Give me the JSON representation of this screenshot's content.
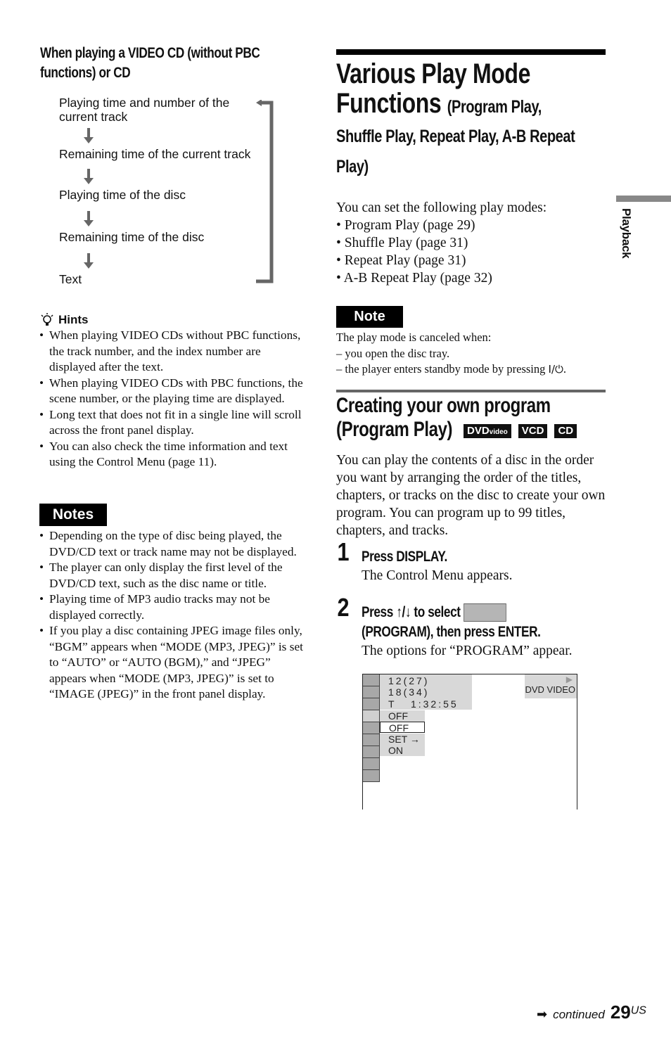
{
  "left": {
    "heading": "When playing a VIDEO CD (without PBC functions) or CD",
    "flow": [
      "Playing time and number of the current track",
      "Remaining time of the current track",
      "Playing time of the disc",
      "Remaining time of the disc",
      "Text"
    ],
    "hints": {
      "title": "Hints",
      "icon": "lightbulb-icon",
      "items": [
        "When playing VIDEO CDs without PBC functions, the track number, and the index number are displayed after the text.",
        "When playing VIDEO CDs with PBC functions, the scene number, or the playing time are displayed.",
        "Long text that does not fit in a single line will scroll across the front panel display.",
        "You can also check the time information and text using the Control Menu (page 11)."
      ]
    },
    "notes": {
      "title": "Notes",
      "items": [
        "Depending on the type of disc being played, the DVD/CD text or track name may not be displayed.",
        "The player can only display the first level of the DVD/CD text, such as the disc name or title.",
        "Playing time of MP3 audio tracks may not be displayed correctly.",
        " If you play a disc containing JPEG image files only, “BGM” appears when “MODE (MP3, JPEG)” is set to “AUTO” or “AUTO (BGM),” and “JPEG” appears when “MODE (MP3, JPEG)” is set to “IMAGE (JPEG)” in the front panel display."
      ]
    }
  },
  "right": {
    "title_main_1": "Various Play Mode",
    "title_main_2": "Functions",
    "title_sub_1": "(Program Play,",
    "title_sub_2": "Shuffle Play, Repeat Play, A-B Repeat",
    "title_sub_3": "Play)",
    "intro": "You can set the following play modes:",
    "modes": [
      "Program Play (page 29)",
      "Shuffle Play (page 31)",
      "Repeat Play (page 31)",
      "A-B Repeat Play (page 32)"
    ],
    "note": {
      "title": "Note",
      "line1": "The play mode is canceled when:",
      "line2": "– you open the disc tray.",
      "line3": "– the player enters standby mode by pressing ",
      "power_symbol": "I/⏻",
      "line3_end": "."
    },
    "section": {
      "title_1": "Creating your own program",
      "title_2": "(Program Play)",
      "badges": [
        "DVD",
        "VCD",
        "CD"
      ],
      "badge_dvd_small": "video",
      "body": "You can play the contents of a disc in the order you want by arranging the order of the titles, chapters, or tracks on the disc to create your own program. You can program up to 99 titles, chapters, and tracks."
    },
    "steps": [
      {
        "number": "1",
        "title": "Press DISPLAY.",
        "body": "The Control Menu appears."
      },
      {
        "number": "2",
        "title_a": "Press ↑/↓ to select",
        "title_b": "(PROGRAM), then press ENTER.",
        "body": "The options for “PROGRAM” appear."
      }
    ],
    "osd": {
      "lines": [
        "12(27)",
        "18(34)",
        "T   1:32:55"
      ],
      "options": [
        "OFF",
        "OFF",
        "SET →",
        "ON"
      ],
      "selected_index": 1,
      "disc_type": "DVD VIDEO",
      "play_icon": "▶"
    }
  },
  "side_tab": "Playback",
  "footer": {
    "arrow": "➡",
    "continued": "continued",
    "page": "29",
    "suffix": "US"
  }
}
